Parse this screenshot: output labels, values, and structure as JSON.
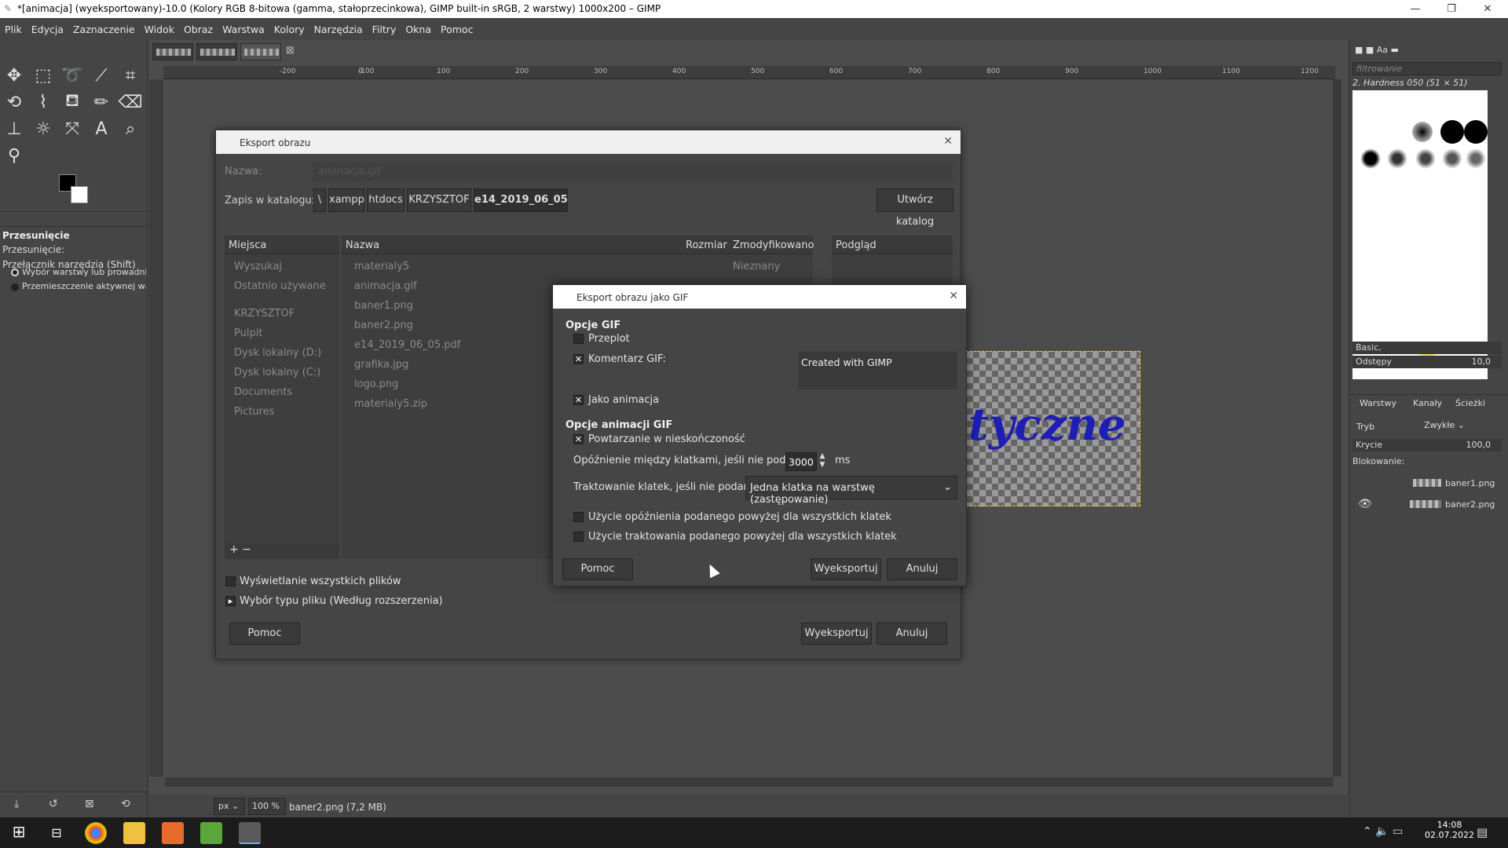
{
  "window": {
    "title": "*[animacja] (wyeksportowany)-10.0 (Kolory RGB 8-bitowa (gamma, stałoprzecinkowa), GIMP built-in sRGB, 2 warstwy) 1000x200 – GIMP",
    "min": "—",
    "max": "❐",
    "close": "✕"
  },
  "menu": [
    "Plik",
    "Edycja",
    "Zaznaczenie",
    "Widok",
    "Obraz",
    "Warstwa",
    "Kolory",
    "Narzędzia",
    "Filtry",
    "Okna",
    "Pomoc"
  ],
  "ruler_labels": [
    "-200",
    "-100",
    "0",
    "100",
    "200",
    "300",
    "400",
    "500",
    "600",
    "700",
    "800",
    "900",
    "1000",
    "1100",
    "1200"
  ],
  "tool_options": {
    "title": "Przesunięcie",
    "mode_label": "Przesunięcie:",
    "switch_label": "Przełącznik narzędzia (Shift)",
    "radio1": "Wybór warstwy lub prowadnicy",
    "radio2": "Przemieszczenie aktywnej warstwy"
  },
  "status": {
    "unit": "px",
    "zoom": "100 %",
    "file": "baner2.png (7,2 MB)"
  },
  "export_dialog": {
    "title": "Eksport obrazu",
    "name_label": "Nazwa:",
    "name_value": "animacja.gif",
    "folder_label": "Zapis w katalogu:",
    "crumbs": [
      "\\",
      "xampp",
      "htdocs",
      "KRZYSZTOF",
      "e14_2019_06_05"
    ],
    "create_folder": "Utwórz katalog",
    "places_header": "Miejsca",
    "places": [
      "Wyszukaj",
      "Ostatnio używane",
      "KRZYSZTOF",
      "Pulpit",
      "Dysk lokalny (D:)",
      "Dysk lokalny (C:)",
      "Documents",
      "Pictures"
    ],
    "col_name": "Nazwa",
    "col_size": "Rozmiar",
    "col_modified": "Zmodyfikowano",
    "preview_header": "Podgląd",
    "unknown": "Nieznany",
    "files": [
      "materialy5",
      "animacja.gif",
      "baner1.png",
      "baner2.png",
      "e14_2019_06_05.pdf",
      "grafika.jpg",
      "logo.png",
      "materialy5.zip"
    ],
    "show_all": "Wyświetlanie wszystkich plików",
    "file_type": "Wybór typu pliku (Według rozszerzenia)",
    "help": "Pomoc",
    "export": "Wyeksportuj",
    "cancel": "Anuluj"
  },
  "gif_dialog": {
    "title": "Eksport obrazu jako GIF",
    "section1": "Opcje GIF",
    "interlace": "Przeplot",
    "comment_label": "Komentarz GIF:",
    "comment_value": "Created with GIMP",
    "as_animation": "Jako animacja",
    "section2": "Opcje animacji GIF",
    "loop": "Powtarzanie w nieskończoność",
    "delay_label": "Opóźnienie między klatkami, jeśli nie podano:",
    "delay_value": "3000",
    "delay_unit": "ms",
    "disposal_label": "Traktowanie klatek, jeśli nie podano:",
    "disposal_value": "Jedna klatka na warstwę (zastępowanie)",
    "use_delay": "Użycie opóźnienia podanego powyżej dla wszystkich klatek",
    "use_disposal": "Użycie traktowania podanego powyżej dla wszystkich klatek",
    "help": "Pomoc",
    "export": "Wyeksportuj",
    "cancel": "Anuluj",
    "checked": {
      "interlace": false,
      "comment": true,
      "as_animation": true,
      "loop": true,
      "use_delay": false,
      "use_disposal": false
    }
  },
  "canvas_text": "tyczne",
  "right_panel": {
    "filter_placeholder": "filtrowanie",
    "brush_name": "2. Hardness 050 (51 × 51)",
    "brush_set": "Basic,",
    "spacing_label": "Odstępy",
    "spacing_value": "10,0",
    "tabs": [
      "Warstwy",
      "Kanały",
      "Ścieżki"
    ],
    "mode_label": "Tryb",
    "mode_value": "Zwykłe",
    "opacity_label": "Krycie",
    "opacity_value": "100,0",
    "lock_label": "Blokowanie:",
    "layers": [
      "baner1.png",
      "baner2.png"
    ]
  },
  "taskbar": {
    "time": "14:08",
    "date": "02.07.2022"
  },
  "colors": {
    "accent": "#2020b0",
    "bg": "#454545",
    "dialog_header": "#f0f0f0"
  }
}
